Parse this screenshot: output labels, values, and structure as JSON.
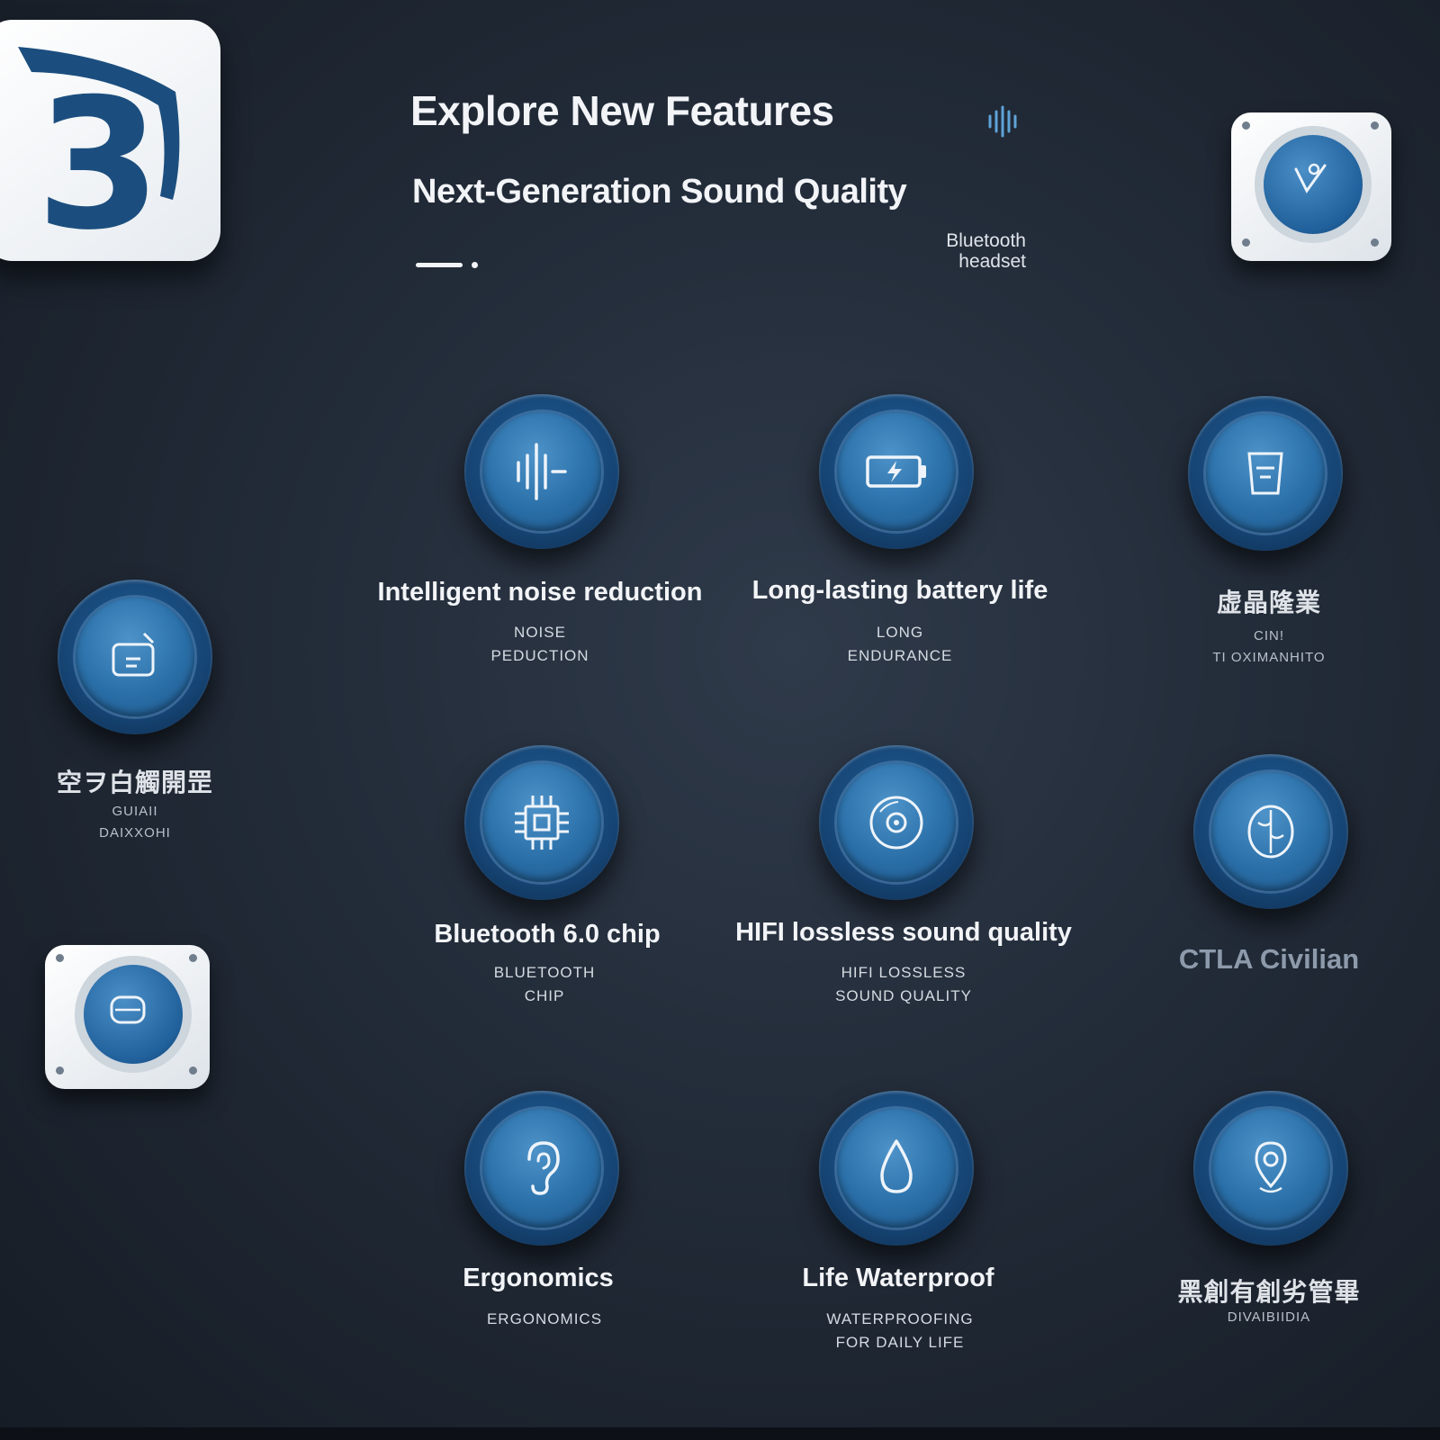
{
  "logo": {
    "number": "3"
  },
  "header": {
    "title": "Explore New Features",
    "subtitle": "Next-Generation Sound Quality",
    "tag_line1": "Bluetooth",
    "tag_line2": "headset"
  },
  "features": [
    {
      "label": "Intelligent noise reduction",
      "sub": "NOISE\nPEDUCTION",
      "icon": "sound-wave-icon"
    },
    {
      "label": "Long-lasting battery life",
      "sub": "LONG\nENDURANCE",
      "icon": "battery-icon"
    },
    {
      "label": "Bluetooth 6.0 chip",
      "sub": "BLUETOOTH\nCHIP",
      "icon": "chip-icon"
    },
    {
      "label": "HIFI lossless sound quality",
      "sub": "HIFI LOSSLESS\nSOUND QUALITY",
      "icon": "disc-icon"
    },
    {
      "label": "Ergonomics",
      "sub": "ERGONOMICS",
      "icon": "ear-icon"
    },
    {
      "label": "Life Waterproof",
      "sub": "WATERPROOFING\nFOR DAILY LIFE",
      "icon": "water-drop-icon"
    }
  ],
  "side_items": {
    "right_top_glyphs": "虚晶隆業",
    "right_top_sub": "CIN!\nTI OXIMANHITO",
    "right_middle_label": "CTLA Civilian",
    "right_bottom_glyphs": "黑創有創劣管畢",
    "right_bottom_sub": "DIVAIBIIDIA",
    "left_glyphs": "空ヲ白觸開罡",
    "left_sub": "GUIAII\nDAIXXOHI"
  },
  "colors": {
    "accent": "#2a6fa8",
    "background": "#222b38",
    "text": "#f2f4f7"
  }
}
